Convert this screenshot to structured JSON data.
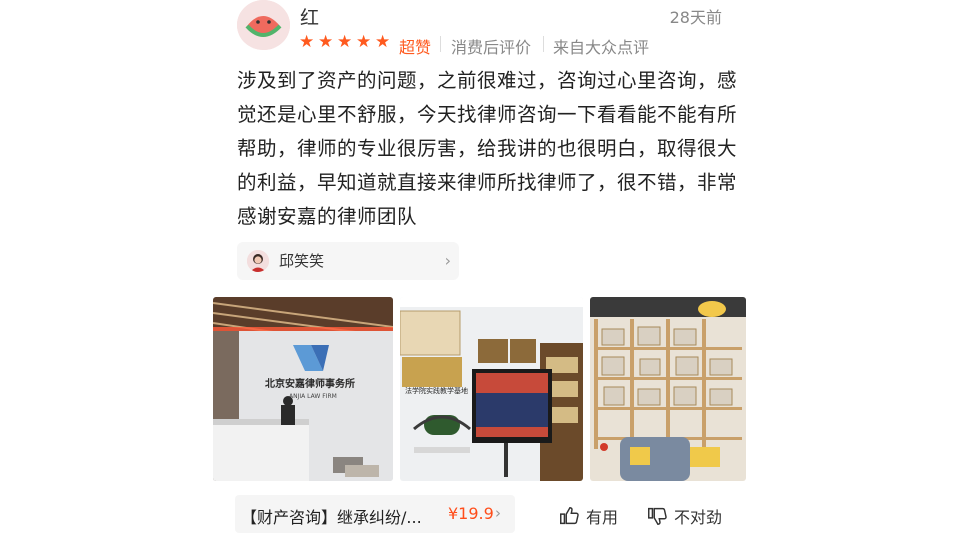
{
  "user": {
    "name": "红",
    "time": "28天前"
  },
  "rating": {
    "stars": 5,
    "label": "超赞"
  },
  "meta": {
    "source1": "消费后评价",
    "source2": "来自大众点评"
  },
  "review": {
    "text": "涉及到了资产的问题，之前很难过，咨询过心里咨询，感觉还是心里不舒服，今天找律师咨询一下看看能不能有所帮助，律师的专业很厉害，给我讲的也很明白，取得很大的利益，早知道就直接来律师所找律师了，很不错，非常感谢安嘉的律师团队"
  },
  "lawyer": {
    "name": "邱笑笑"
  },
  "photos": {
    "photo1": {
      "sign_top": "北京安嘉律师事务所",
      "sign_bottom": "ANJIA LAW FIRM"
    },
    "photo2": {
      "plaque": "法学院实践教学基地"
    },
    "photo3": {}
  },
  "product": {
    "title": "【财产咨询】继承纠纷/...",
    "price": "¥19.9"
  },
  "actions": {
    "useful": "有用",
    "wrong": "不对劲"
  },
  "icons": {
    "star": "star-icon",
    "chevron": "chevron-right-icon",
    "thumb_up": "thumb-up-icon",
    "thumb_down": "thumb-down-icon"
  }
}
